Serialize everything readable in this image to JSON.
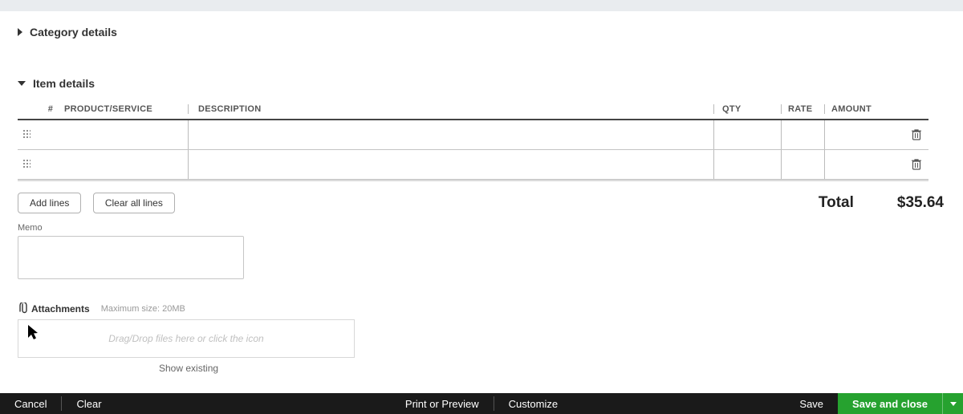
{
  "sections": {
    "category_details": "Category details",
    "item_details": "Item details"
  },
  "table": {
    "headers": {
      "num": "#",
      "product": "PRODUCT/SERVICE",
      "description": "DESCRIPTION",
      "qty": "QTY",
      "rate": "RATE",
      "amount": "AMOUNT"
    }
  },
  "buttons": {
    "add_lines": "Add lines",
    "clear_lines": "Clear all lines"
  },
  "totals": {
    "label": "Total",
    "amount": "$35.64"
  },
  "memo": {
    "label": "Memo",
    "value": ""
  },
  "attachments": {
    "label": "Attachments",
    "max_size": "Maximum size: 20MB",
    "dropzone_hint": "Drag/Drop files here or click the icon",
    "show_existing": "Show existing"
  },
  "footer": {
    "cancel": "Cancel",
    "clear": "Clear",
    "print": "Print or Preview",
    "customize": "Customize",
    "save": "Save",
    "save_close": "Save and close"
  }
}
